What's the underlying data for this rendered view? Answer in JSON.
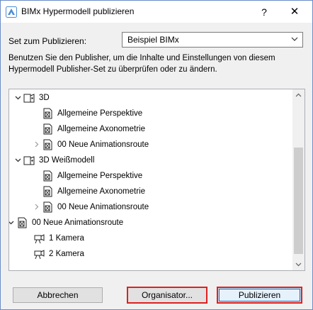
{
  "window": {
    "title": "BIMx Hypermodell publizieren",
    "help_glyph": "?",
    "close_glyph": "✕",
    "border_color": "#6b8cc7"
  },
  "set_select": {
    "label": "Set zum Publizieren:",
    "value": "Beispiel BIMx"
  },
  "description": "Benutzen Sie den Publisher, um die Inhalte und Einstellungen von diesem Hypermodell Publisher-Set zu überprüfen oder zu ändern.",
  "tree": {
    "items": [
      {
        "label": "3D",
        "icon": "view-map-folder-icon",
        "expander": "expanded"
      },
      {
        "label": "Allgemeine Perspektive",
        "icon": "3d-view-document-icon",
        "expander": "none"
      },
      {
        "label": "Allgemeine Axonometrie",
        "icon": "3d-view-document-icon",
        "expander": "none"
      },
      {
        "label": "00 Neue Animationsroute",
        "icon": "3d-view-document-icon",
        "expander": "collapsed"
      },
      {
        "label": "3D Weißmodell",
        "icon": "view-map-folder-icon",
        "expander": "expanded"
      },
      {
        "label": "Allgemeine Perspektive",
        "icon": "3d-view-document-icon",
        "expander": "none"
      },
      {
        "label": "Allgemeine Axonometrie",
        "icon": "3d-view-document-icon",
        "expander": "none"
      },
      {
        "label": "00 Neue Animationsroute",
        "icon": "3d-view-document-icon",
        "expander": "collapsed"
      },
      {
        "label": "00 Neue Animationsroute",
        "icon": "3d-view-document-icon",
        "expander": "expanded"
      },
      {
        "label": "1 Kamera",
        "icon": "camera-icon",
        "expander": "none"
      },
      {
        "label": "2 Kamera",
        "icon": "camera-icon",
        "expander": "none"
      }
    ]
  },
  "buttons": {
    "cancel": "Abbrechen",
    "organizer": "Organisator...",
    "publish": "Publizieren"
  },
  "colors": {
    "highlight_border": "#e02020",
    "default_button_accent": "#0078d7"
  }
}
